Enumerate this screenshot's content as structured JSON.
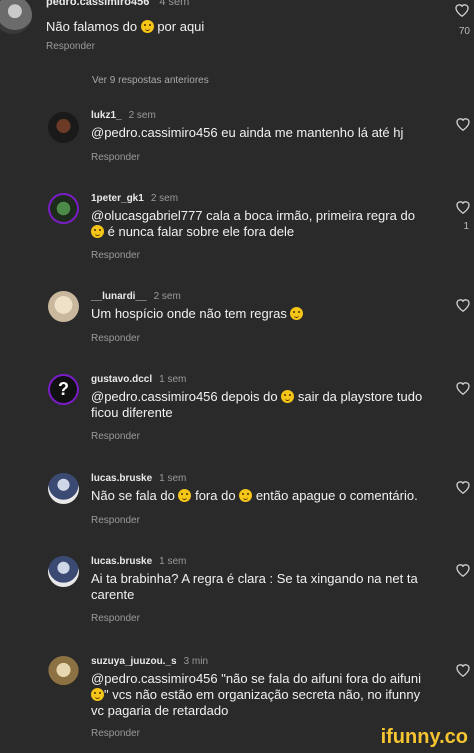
{
  "top_comment": {
    "username": "pedro.cassimiro456",
    "time": "4 sem",
    "text_before": "Não falamos do",
    "text_after": "por aqui",
    "reply_label": "Responder",
    "likes": "70"
  },
  "view_more": "Ver 9 respostas anteriores",
  "comments": [
    {
      "username": "lukz1_",
      "time": "2 sem",
      "text": "@pedro.cassimiro456 eu ainda me mantenho lá até hj",
      "reply_label": "Responder",
      "likes": ""
    },
    {
      "username": "1peter_gk1",
      "time": "2 sem",
      "text_before": "@olucasgabriel777 cala a boca irmão, primeira regra do",
      "text_after": "é nunca falar sobre ele fora dele",
      "reply_label": "Responder",
      "likes": "1"
    },
    {
      "username": "__lunardi__",
      "time": "2 sem",
      "text_before": "Um hospício onde não tem regras",
      "reply_label": "Responder",
      "likes": ""
    },
    {
      "username": "gustavo.dccl",
      "time": "1 sem",
      "text_before": "@pedro.cassimiro456 depois do",
      "text_after": "sair da playstore tudo ficou diferente",
      "reply_label": "Responder",
      "likes": ""
    },
    {
      "username": "lucas.bruske",
      "time": "1 sem",
      "text_before": "Não se fala do",
      "text_mid": "fora do",
      "text_after": "então apague o comentário.",
      "reply_label": "Responder",
      "likes": ""
    },
    {
      "username": "lucas.bruske",
      "time": "1 sem",
      "text": "Ai ta brabinha? A regra é clara : Se ta xingando na net ta carente",
      "reply_label": "Responder",
      "likes": ""
    },
    {
      "username": "suzuya_juuzou._s",
      "time": "3 min",
      "text_before": "@pedro.cassimiro456 \"não se fala do aifuni fora do aifuni",
      "text_after": "\" vcs não estão em organização secreta não, no ifunny vc pagaria de retardado",
      "reply_label": "Responder",
      "likes": ""
    }
  ],
  "watermark": "ifunny.co"
}
